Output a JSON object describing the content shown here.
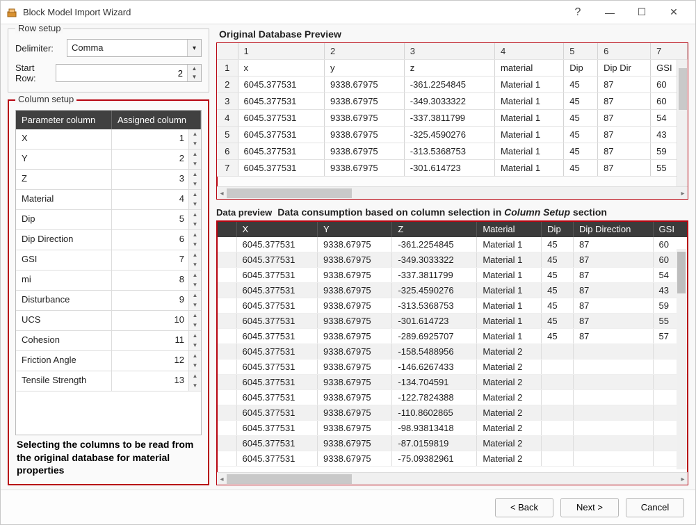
{
  "titlebar": {
    "title": "Block Model Import Wizard"
  },
  "row_setup": {
    "legend": "Row setup",
    "delimiter_label": "Delimiter:",
    "delimiter_value": "Comma",
    "start_row_label": "Start Row:",
    "start_row_value": "2"
  },
  "column_setup": {
    "legend": "Column setup",
    "header_param": "Parameter column",
    "header_assigned": "Assigned column",
    "rows": [
      {
        "param": "X",
        "assigned": "1"
      },
      {
        "param": "Y",
        "assigned": "2"
      },
      {
        "param": "Z",
        "assigned": "3"
      },
      {
        "param": "Material",
        "assigned": "4"
      },
      {
        "param": "Dip",
        "assigned": "5"
      },
      {
        "param": "Dip Direction",
        "assigned": "6"
      },
      {
        "param": "GSI",
        "assigned": "7"
      },
      {
        "param": "mi",
        "assigned": "8"
      },
      {
        "param": "Disturbance",
        "assigned": "9"
      },
      {
        "param": "UCS",
        "assigned": "10"
      },
      {
        "param": "Cohesion",
        "assigned": "11"
      },
      {
        "param": "Friction Angle",
        "assigned": "12"
      },
      {
        "param": "Tensile Strength",
        "assigned": "13"
      }
    ],
    "annotation": "Selecting the columns to be read from the original database for material properties"
  },
  "orig_preview": {
    "label": "Original Database Preview",
    "col_nums": [
      "1",
      "2",
      "3",
      "4",
      "5",
      "6",
      "7"
    ],
    "rows": [
      {
        "n": "1",
        "c": [
          "x",
          "y",
          "z",
          "material",
          "Dip",
          "Dip Dir",
          "GSI"
        ]
      },
      {
        "n": "2",
        "c": [
          "6045.377531",
          "9338.67975",
          "-361.2254845",
          "Material 1",
          "45",
          "87",
          "60"
        ]
      },
      {
        "n": "3",
        "c": [
          "6045.377531",
          "9338.67975",
          "-349.3033322",
          "Material 1",
          "45",
          "87",
          "60"
        ]
      },
      {
        "n": "4",
        "c": [
          "6045.377531",
          "9338.67975",
          "-337.3811799",
          "Material 1",
          "45",
          "87",
          "54"
        ]
      },
      {
        "n": "5",
        "c": [
          "6045.377531",
          "9338.67975",
          "-325.4590276",
          "Material 1",
          "45",
          "87",
          "43"
        ]
      },
      {
        "n": "6",
        "c": [
          "6045.377531",
          "9338.67975",
          "-313.5368753",
          "Material 1",
          "45",
          "87",
          "59"
        ]
      },
      {
        "n": "7",
        "c": [
          "6045.377531",
          "9338.67975",
          "-301.614723",
          "Material 1",
          "45",
          "87",
          "55"
        ]
      }
    ]
  },
  "data_preview": {
    "label": "Data preview",
    "desc_prefix": "Data consumption based on column selection in ",
    "desc_italic": "Column Setup",
    "desc_suffix": " section",
    "headers": [
      "X",
      "Y",
      "Z",
      "Material",
      "Dip",
      "Dip Direction",
      "GSI"
    ],
    "rows": [
      [
        "6045.377531",
        "9338.67975",
        "-361.2254845",
        "Material 1",
        "45",
        "87",
        "60"
      ],
      [
        "6045.377531",
        "9338.67975",
        "-349.3033322",
        "Material 1",
        "45",
        "87",
        "60"
      ],
      [
        "6045.377531",
        "9338.67975",
        "-337.3811799",
        "Material 1",
        "45",
        "87",
        "54"
      ],
      [
        "6045.377531",
        "9338.67975",
        "-325.4590276",
        "Material 1",
        "45",
        "87",
        "43"
      ],
      [
        "6045.377531",
        "9338.67975",
        "-313.5368753",
        "Material 1",
        "45",
        "87",
        "59"
      ],
      [
        "6045.377531",
        "9338.67975",
        "-301.614723",
        "Material 1",
        "45",
        "87",
        "55"
      ],
      [
        "6045.377531",
        "9338.67975",
        "-289.6925707",
        "Material 1",
        "45",
        "87",
        "57"
      ],
      [
        "6045.377531",
        "9338.67975",
        "-158.5488956",
        "Material 2",
        "",
        "",
        ""
      ],
      [
        "6045.377531",
        "9338.67975",
        "-146.6267433",
        "Material 2",
        "",
        "",
        ""
      ],
      [
        "6045.377531",
        "9338.67975",
        "-134.704591",
        "Material 2",
        "",
        "",
        ""
      ],
      [
        "6045.377531",
        "9338.67975",
        "-122.7824388",
        "Material 2",
        "",
        "",
        ""
      ],
      [
        "6045.377531",
        "9338.67975",
        "-110.8602865",
        "Material 2",
        "",
        "",
        ""
      ],
      [
        "6045.377531",
        "9338.67975",
        "-98.93813418",
        "Material 2",
        "",
        "",
        ""
      ],
      [
        "6045.377531",
        "9338.67975",
        "-87.0159819",
        "Material 2",
        "",
        "",
        ""
      ],
      [
        "6045.377531",
        "9338.67975",
        "-75.09382961",
        "Material 2",
        "",
        "",
        ""
      ]
    ]
  },
  "footer": {
    "back": "< Back",
    "next": "Next >",
    "cancel": "Cancel"
  }
}
